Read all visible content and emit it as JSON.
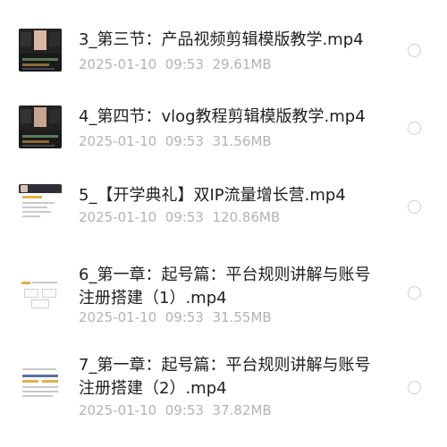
{
  "files": [
    {
      "title": "3_第三节：产品视频剪辑模版教学.mp4",
      "date": "2025-01-10",
      "time": "09:53",
      "size": "29.61MB",
      "thumb": "video-editor-thumbnail"
    },
    {
      "title": "4_第四节：vlog教程剪辑模版教学.mp4",
      "date": "2025-01-10",
      "time": "09:53",
      "size": "31.56MB",
      "thumb": "video-editor-thumbnail"
    },
    {
      "title": "5_【开学典礼】双IP流量增长营.mp4",
      "date": "2025-01-10",
      "time": "09:53",
      "size": "120.86MB",
      "thumb": "slide-thumbnail"
    },
    {
      "title_line1": "6_第一章：起号篇：平台规则讲解与账号",
      "title_line2": "注册搭建（1）.mp4",
      "date": "2025-01-10",
      "time": "09:53",
      "size": "31.55MB",
      "thumb": "slide-thumbnail"
    },
    {
      "title_line1": "7_第一章：起号篇：平台规则讲解与账号",
      "title_line2": "注册搭建（2）.mp4",
      "date": "2025-01-10",
      "time": "09:53",
      "size": "37.82MB",
      "thumb": "slide-thumbnail"
    }
  ]
}
